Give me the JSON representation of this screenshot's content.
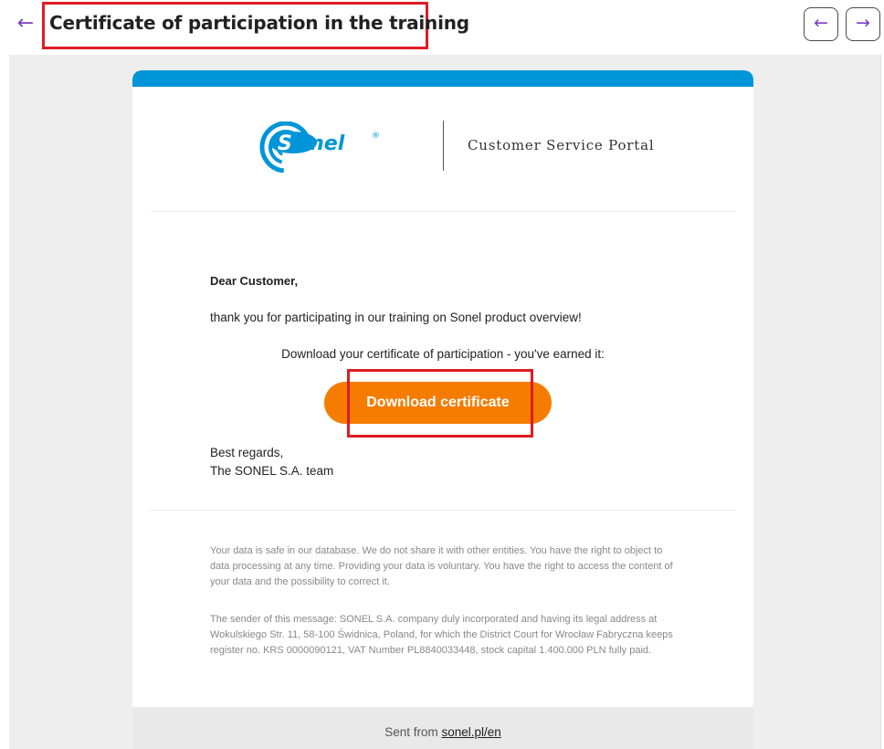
{
  "header": {
    "back_glyph": "←",
    "title": "Certificate of participation in the training",
    "prev_glyph": "←",
    "next_glyph": "→"
  },
  "email": {
    "logo_text": "Sonel",
    "logo_mark": "®",
    "portal_name": "Customer Service Portal",
    "greeting": "Dear Customer,",
    "message_line1": "thank you for participating in our training on Sonel product overview!",
    "message_line2": "Download your certificate of participation - you've earned it:",
    "download_button": "Download certificate",
    "regards_line1": "Best regards,",
    "regards_line2": "The SONEL S.A. team",
    "privacy_notice": "Your data is safe in our database. We do not share it with other entities. You have the right to object to data processing at any time. Providing your data is voluntary. You have the right to access the content of your data and the possibility to correct it.",
    "sender_notice": "The sender of this message: SONEL S.A. company duly incorporated and having its legal address at Wokulskiego Str. 11, 58-100 Świdnica, Poland, for which the District Court for Wrocław Fabryczna keeps register no. KRS 0000090121, VAT Number PL8840033448, stock capital 1.400.000 PLN fully paid.",
    "footer_prefix": "Sent from ",
    "footer_link": "sonel.pl/en"
  },
  "colors": {
    "accent_purple": "#7b3fc4",
    "brand_blue": "#0095d8",
    "button_orange": "#f57c00",
    "highlight_red": "#e01b24"
  },
  "icons": {
    "back": "arrow-left-icon",
    "prev": "arrow-left-icon",
    "next": "arrow-right-icon"
  }
}
